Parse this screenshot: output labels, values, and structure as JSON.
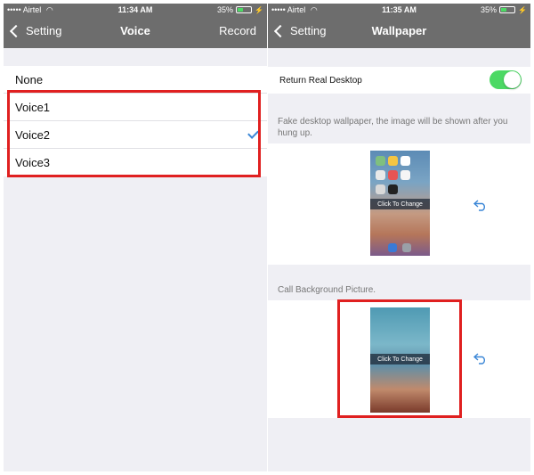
{
  "left": {
    "status": {
      "carrier": "Airtel",
      "time": "11:34 AM",
      "battery": "35%"
    },
    "nav": {
      "back_label": "Setting",
      "title": "Voice",
      "right_label": "Record"
    },
    "voices": [
      {
        "label": "None",
        "selected": false
      },
      {
        "label": "Voice1",
        "selected": false
      },
      {
        "label": "Voice2",
        "selected": true
      },
      {
        "label": "Voice3",
        "selected": false
      }
    ]
  },
  "right": {
    "status": {
      "carrier": "Airtel",
      "time": "11:35 AM",
      "battery": "35%"
    },
    "nav": {
      "back_label": "Setting",
      "title": "Wallpaper"
    },
    "return_desktop": {
      "label": "Return Real Desktop",
      "enabled": true
    },
    "fake_note": "Fake desktop wallpaper, the image will be shown after you hung up.",
    "fake_thumb_caption": "Click To Change",
    "call_bg_note": "Call Background Picture.",
    "call_thumb_caption": "Click To Change"
  },
  "colors": {
    "nav_bg": "#6d6d6d",
    "highlight": "#e02020",
    "toggle_on": "#4cd964",
    "checkmark": "#3a86d6",
    "background": "#efeff4"
  }
}
